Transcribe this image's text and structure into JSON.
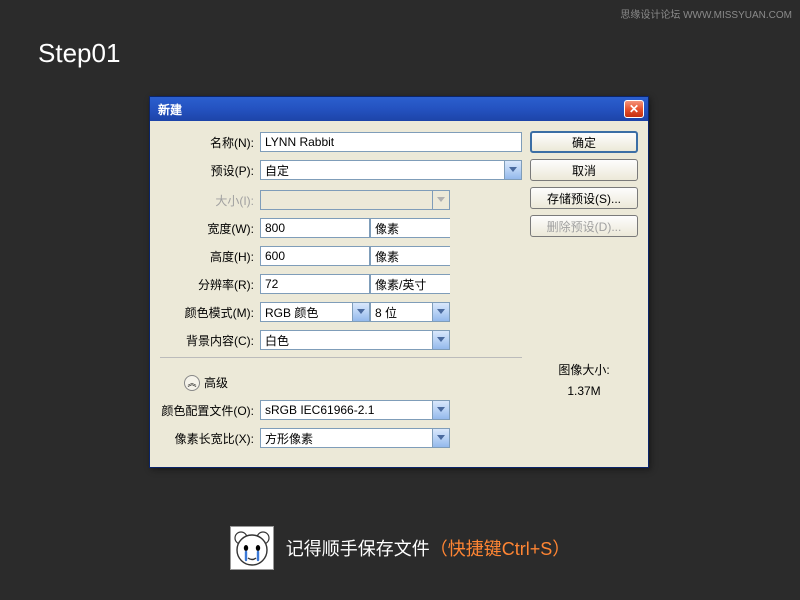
{
  "watermark": {
    "text": "思缘设计论坛",
    "url": "WWW.MISSYUAN.COM"
  },
  "step_label": "Step01",
  "dialog": {
    "title": "新建",
    "close_x": "✕",
    "labels": {
      "name": "名称(N):",
      "preset": "预设(P):",
      "size": "大小(I):",
      "width": "宽度(W):",
      "height": "高度(H):",
      "resolution": "分辨率(R):",
      "color_mode": "颜色模式(M):",
      "bg_content": "背景内容(C):",
      "advanced": "高级",
      "color_profile": "颜色配置文件(O):",
      "pixel_aspect": "像素长宽比(X):"
    },
    "values": {
      "name": "LYNN Rabbit",
      "preset": "自定",
      "size": "",
      "width": "800",
      "width_unit": "像素",
      "height": "600",
      "height_unit": "像素",
      "resolution": "72",
      "resolution_unit": "像素/英寸",
      "color_mode": "RGB 颜色",
      "color_bits": "8 位",
      "bg_content": "白色",
      "color_profile": "sRGB IEC61966-2.1",
      "pixel_aspect": "方形像素"
    },
    "buttons": {
      "ok": "确定",
      "cancel": "取消",
      "save_preset": "存储预设(S)...",
      "delete_preset": "删除预设(D)..."
    },
    "img_size": {
      "label": "图像大小:",
      "value": "1.37M"
    },
    "adv_toggle_glyph": "︽"
  },
  "footer": {
    "text_white": "记得顺手保存文件",
    "text_orange": "（快捷键Ctrl+S）"
  }
}
